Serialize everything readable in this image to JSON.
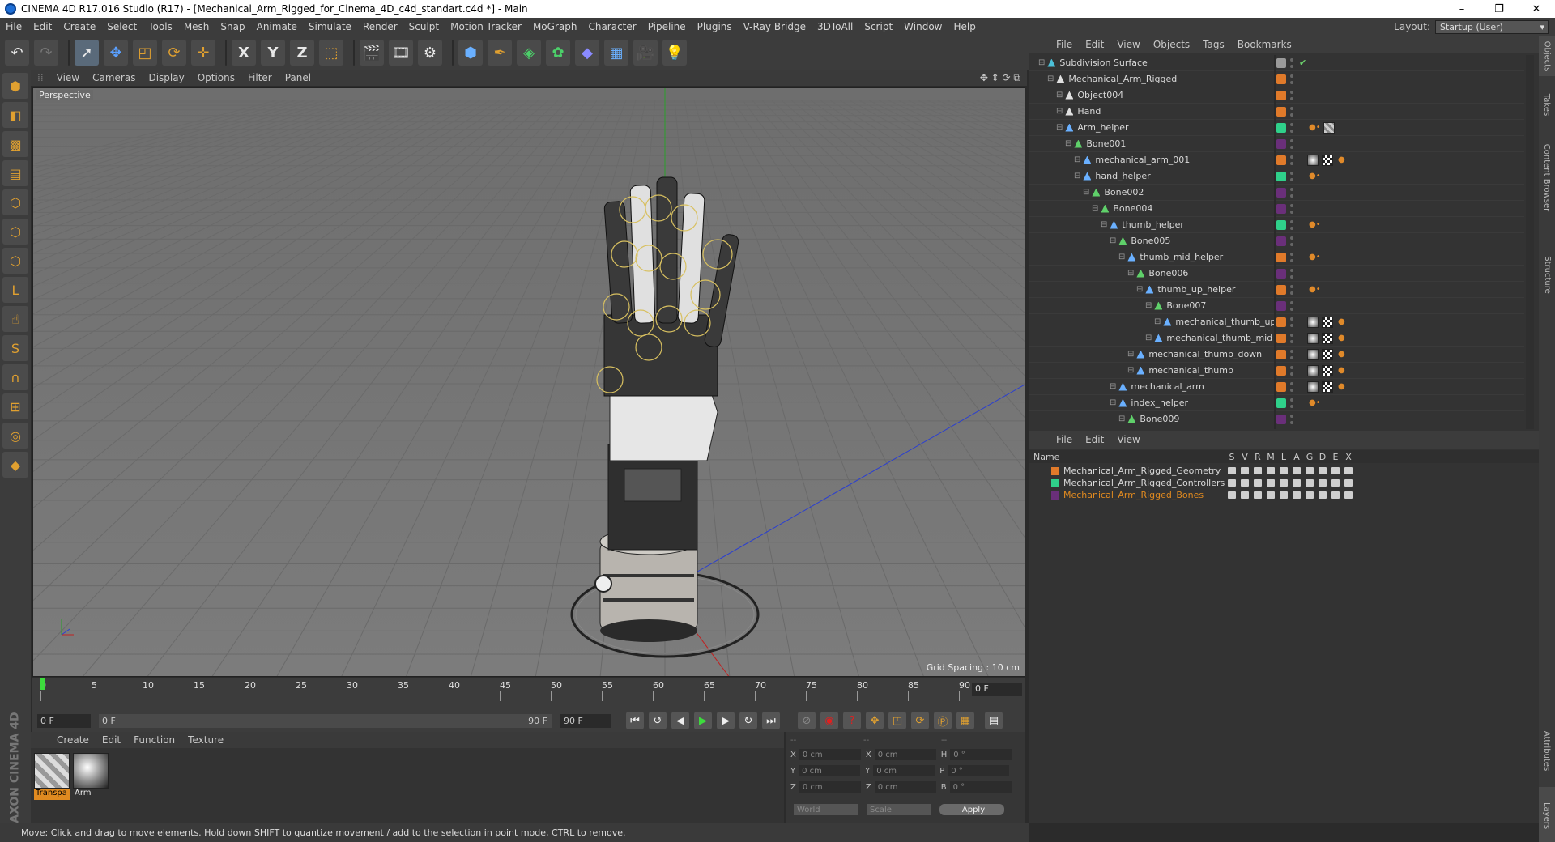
{
  "window": {
    "title": "CINEMA 4D R17.016 Studio (R17) - [Mechanical_Arm_Rigged_for_Cinema_4D_c4d_standart.c4d *] - Main",
    "controls": [
      "–",
      "❐",
      "✕"
    ]
  },
  "menu": [
    "File",
    "Edit",
    "Create",
    "Select",
    "Tools",
    "Mesh",
    "Snap",
    "Animate",
    "Simulate",
    "Render",
    "Sculpt",
    "Motion Tracker",
    "MoGraph",
    "Character",
    "Pipeline",
    "Plugins",
    "V-Ray Bridge",
    "3DToAll",
    "Script",
    "Window",
    "Help"
  ],
  "layout": {
    "label": "Layout:",
    "value": "Startup (User)"
  },
  "toolbar": {
    "icons": [
      "undo-icon",
      "redo-icon",
      "select-arrow-icon",
      "move-icon",
      "scale-icon",
      "rotate-icon",
      "move-axis-icon",
      "x-axis-icon",
      "y-axis-icon",
      "z-axis-icon",
      "coordinate-system-icon",
      "render-view-icon",
      "render-picture-viewer-icon",
      "render-settings-icon",
      "cube-icon",
      "pen-spline-icon",
      "subdivision-icon",
      "array-icon",
      "deformer-icon",
      "floor-icon",
      "camera-icon",
      "light-icon"
    ],
    "axis_labels": [
      "X",
      "Y",
      "Z"
    ]
  },
  "left_tools": [
    "model-mode-icon",
    "object-mode-icon",
    "texture-mode-icon",
    "workplane-icon",
    "points-mode-icon",
    "edges-mode-icon",
    "polygons-mode-icon",
    "axis-mode-icon",
    "tweak-icon",
    "soft-selection-icon",
    "magnet-icon",
    "snap-icon",
    "solo-icon",
    "python-icon"
  ],
  "viewport": {
    "menu": [
      "View",
      "Cameras",
      "Display",
      "Options",
      "Filter",
      "Panel"
    ],
    "label": "Perspective",
    "grid_spacing": "Grid Spacing : 10 cm"
  },
  "timeline": {
    "ticks": [
      "0",
      "5",
      "10",
      "15",
      "20",
      "25",
      "30",
      "35",
      "40",
      "45",
      "50",
      "55",
      "60",
      "65",
      "70",
      "75",
      "80",
      "85",
      "90"
    ],
    "current": "0 F"
  },
  "transport": {
    "start": "0 F",
    "range_start": "0 F",
    "range_end": "90 F",
    "end": "90 F"
  },
  "materials": {
    "menu": [
      "Create",
      "Edit",
      "Function",
      "Texture"
    ],
    "items": [
      {
        "name": "Transpa",
        "selected": true
      },
      {
        "name": "Arm",
        "selected": false
      }
    ]
  },
  "coords": {
    "headers": [
      "--",
      "--",
      "--"
    ],
    "rows": [
      {
        "a": "X",
        "av": "0 cm",
        "b": "X",
        "bv": "0 cm",
        "c": "H",
        "cv": "0 °"
      },
      {
        "a": "Y",
        "av": "0 cm",
        "b": "Y",
        "bv": "0 cm",
        "c": "P",
        "cv": "0 °"
      },
      {
        "a": "Z",
        "av": "0 cm",
        "b": "Z",
        "bv": "0 cm",
        "c": "B",
        "cv": "0 °"
      }
    ],
    "world": "World",
    "scale": "Scale",
    "apply": "Apply"
  },
  "status": "Move: Click and drag to move elements. Hold down SHIFT to quantize movement / add to the selection in point mode, CTRL to remove.",
  "objects": {
    "menu": [
      "File",
      "Edit",
      "View",
      "Objects",
      "Tags",
      "Bookmarks"
    ],
    "rows": [
      {
        "name": "Subdivision Surface",
        "depth": 0,
        "color": "#9a9a9a",
        "icon": "#4cc0d8",
        "tag": "check"
      },
      {
        "name": "Mechanical_Arm_Rigged",
        "depth": 1,
        "color": "#e07a2a",
        "icon": "#e0e0e0",
        "tag": ""
      },
      {
        "name": "Object004",
        "depth": 2,
        "color": "#e07a2a",
        "icon": "#e0e0e0",
        "tag": ""
      },
      {
        "name": "Hand",
        "depth": 2,
        "color": "#e07a2a",
        "icon": "#e0e0e0",
        "tag": ""
      },
      {
        "name": "Arm_helper",
        "depth": 2,
        "color": "#2fd08a",
        "icon": "#6ab0ff",
        "tag": "helper"
      },
      {
        "name": "Bone001",
        "depth": 3,
        "color": "#6a2f7a",
        "icon": "#5fd06a",
        "tag": ""
      },
      {
        "name": "mechanical_arm_001",
        "depth": 4,
        "color": "#e07a2a",
        "icon": "#6ab0ff",
        "tag": "mat"
      },
      {
        "name": "hand_helper",
        "depth": 4,
        "color": "#2fd08a",
        "icon": "#6ab0ff",
        "tag": "dot"
      },
      {
        "name": "Bone002",
        "depth": 5,
        "color": "#6a2f7a",
        "icon": "#5fd06a",
        "tag": ""
      },
      {
        "name": "Bone004",
        "depth": 6,
        "color": "#6a2f7a",
        "icon": "#5fd06a",
        "tag": ""
      },
      {
        "name": "thumb_helper",
        "depth": 7,
        "color": "#2fd08a",
        "icon": "#6ab0ff",
        "tag": "dot"
      },
      {
        "name": "Bone005",
        "depth": 8,
        "color": "#6a2f7a",
        "icon": "#5fd06a",
        "tag": ""
      },
      {
        "name": "thumb_mid_helper",
        "depth": 9,
        "color": "#e07a2a",
        "icon": "#6ab0ff",
        "tag": "dot"
      },
      {
        "name": "Bone006",
        "depth": 10,
        "color": "#6a2f7a",
        "icon": "#5fd06a",
        "tag": ""
      },
      {
        "name": "thumb_up_helper",
        "depth": 11,
        "color": "#e07a2a",
        "icon": "#6ab0ff",
        "tag": "dot"
      },
      {
        "name": "Bone007",
        "depth": 12,
        "color": "#6a2f7a",
        "icon": "#5fd06a",
        "tag": ""
      },
      {
        "name": "mechanical_thumb_up",
        "depth": 13,
        "color": "#e07a2a",
        "icon": "#6ab0ff",
        "tag": "mat"
      },
      {
        "name": "mechanical_thumb_mid",
        "depth": 12,
        "color": "#e07a2a",
        "icon": "#6ab0ff",
        "tag": "mat"
      },
      {
        "name": "mechanical_thumb_down",
        "depth": 10,
        "color": "#e07a2a",
        "icon": "#6ab0ff",
        "tag": "mat"
      },
      {
        "name": "mechanical_thumb",
        "depth": 10,
        "color": "#e07a2a",
        "icon": "#6ab0ff",
        "tag": "mat"
      },
      {
        "name": "mechanical_arm",
        "depth": 8,
        "color": "#e07a2a",
        "icon": "#6ab0ff",
        "tag": "mat"
      },
      {
        "name": "index_helper",
        "depth": 8,
        "color": "#2fd08a",
        "icon": "#6ab0ff",
        "tag": "dot"
      },
      {
        "name": "Bone009",
        "depth": 9,
        "color": "#6a2f7a",
        "icon": "#5fd06a",
        "tag": ""
      }
    ]
  },
  "layers": {
    "menu": [
      "File",
      "Edit",
      "View"
    ],
    "header": {
      "name": "Name",
      "cols": [
        "S",
        "V",
        "R",
        "M",
        "L",
        "A",
        "G",
        "D",
        "E",
        "X"
      ]
    },
    "rows": [
      {
        "name": "Mechanical_Arm_Rigged_Geometry",
        "color": "#e07a2a",
        "selected": false
      },
      {
        "name": "Mechanical_Arm_Rigged_Controllers",
        "color": "#2fd08a",
        "selected": false
      },
      {
        "name": "Mechanical_Arm_Rigged_Bones",
        "color": "#6a2f7a",
        "selected": true
      }
    ]
  },
  "side_tabs": [
    "Objects",
    "Takes",
    "Content Browser",
    "Structure",
    "Attributes",
    "Layers"
  ]
}
